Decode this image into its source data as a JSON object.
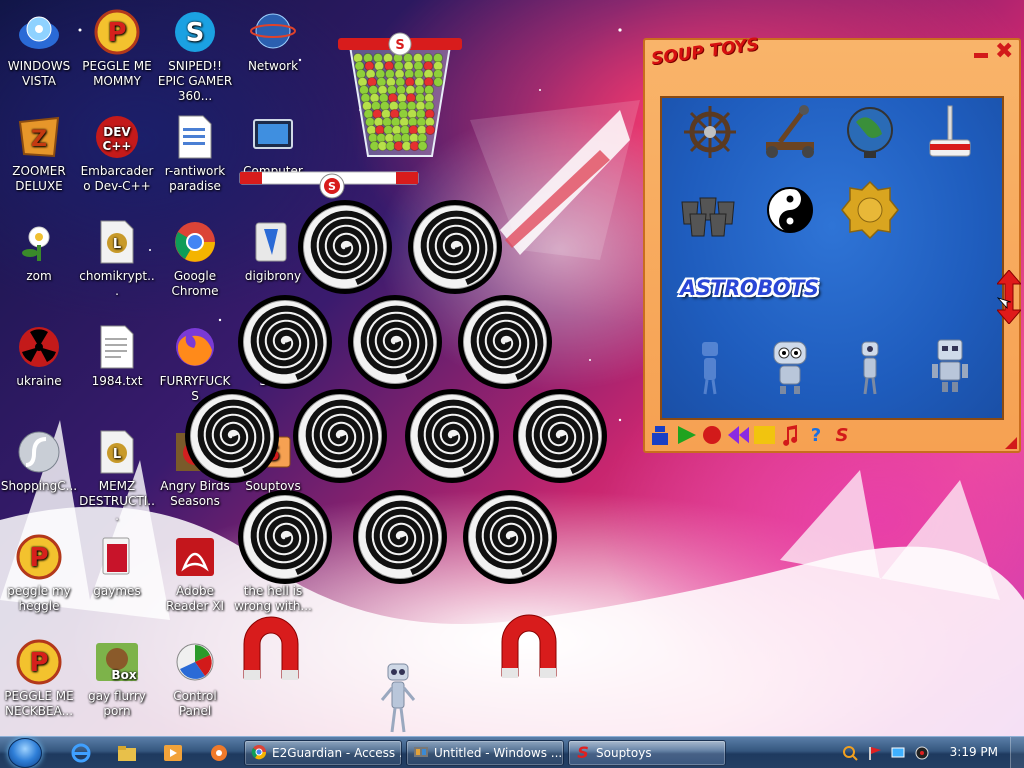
{
  "desktop_icons": [
    {
      "label": "WINDOWS VISTA",
      "icon": "vista-disc-icon"
    },
    {
      "label": "PEGGLE ME MOMMY",
      "icon": "peggle-icon"
    },
    {
      "label": "SNIPED!! EPIC GAMER 360...",
      "icon": "skype-icon"
    },
    {
      "label": "Network",
      "icon": "network-globe-icon"
    },
    {
      "label": "ZOOMER DELUXE",
      "icon": "zuma-icon"
    },
    {
      "label": "Embarcadero Dev-C++",
      "icon": "devcpp-icon"
    },
    {
      "label": "r-antiwork paradise",
      "icon": "document-icon"
    },
    {
      "label": "Computer",
      "icon": "computer-icon"
    },
    {
      "label": "zom",
      "icon": "plant-icon"
    },
    {
      "label": "chomikrypt...",
      "icon": "shortcut-file-icon"
    },
    {
      "label": "Google Chrome",
      "icon": "chrome-icon"
    },
    {
      "label": "digibrony",
      "icon": "digibrony-icon"
    },
    {
      "label": "ukraine",
      "icon": "radiation-icon"
    },
    {
      "label": "1984.txt",
      "icon": "text-file-icon"
    },
    {
      "label": "FURRYFUCKS",
      "icon": "firefox-icon"
    },
    {
      "label": "SC...",
      "icon": "hidden-icon"
    },
    {
      "label": "ShoppingC...",
      "icon": "flash-icon"
    },
    {
      "label": "MEMZ DESTRUCTI...",
      "icon": "shortcut-file-icon"
    },
    {
      "label": "Angry Birds Seasons",
      "icon": "angry-birds-icon"
    },
    {
      "label": "Souptoys",
      "icon": "souptoys-icon"
    },
    {
      "label": "peggle my heggle",
      "icon": "peggle-icon"
    },
    {
      "label": "gaymes",
      "icon": "folder-icon"
    },
    {
      "label": "Adobe Reader XI",
      "icon": "adobe-reader-icon"
    },
    {
      "label": "the hell is wrong with...",
      "icon": "hidden-icon"
    },
    {
      "label": "PEGGLE ME NECKBEA...",
      "icon": "peggle-icon"
    },
    {
      "label": "gay flurry porn",
      "icon": "box-icon"
    },
    {
      "label": "Control Panel",
      "icon": "control-panel-icon"
    }
  ],
  "soup_window": {
    "logo": "SOUP TOYS",
    "section_title": "ASTROBOTS",
    "toys_top": [
      "ship-wheel-icon",
      "catapult-icon",
      "globe-icon",
      "mallet-icon",
      "buckets-icon",
      "yin-yang-icon",
      "gold-coin-icon"
    ],
    "astrobots": [
      "astrobot-ghost-icon",
      "astrobot-round-icon",
      "astrobot-thin-icon",
      "astrobot-box-icon"
    ],
    "toolbar": [
      "robot-tool-icon",
      "play-icon",
      "record-icon",
      "rewind-icon",
      "stop-icon",
      "music-icon",
      "help-icon",
      "souptoys-s-icon"
    ]
  },
  "taskbar": {
    "tasks": [
      {
        "label": "E2Guardian - Access ...",
        "icon": "chrome-icon"
      },
      {
        "label": "Untitled - Windows ...",
        "icon": "movie-maker-icon"
      },
      {
        "label": "Souptoys",
        "icon": "souptoys-s-icon"
      }
    ],
    "clock": "3:19 PM"
  },
  "colors": {
    "soup_orange": "#f6a152",
    "soup_blue": "#1f5dbe",
    "soup_red": "#d21a1a",
    "taskbar": "#243f64"
  }
}
